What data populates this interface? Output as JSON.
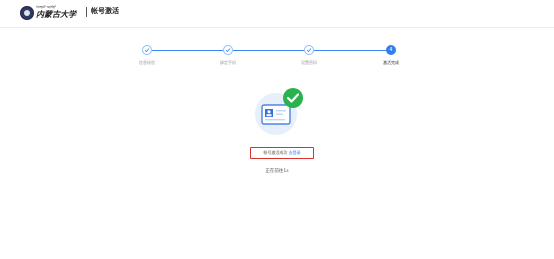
{
  "header": {
    "logo_sub": "ᠮᠣᠩᠭᠣᠯ ᠤᠨᠢᠪᠧᠷ",
    "logo_main": "内蒙古大学",
    "divider": "|",
    "title": "帐号激活"
  },
  "steps": [
    {
      "label": "信息校验",
      "state": "done"
    },
    {
      "label": "绑定手机",
      "state": "done"
    },
    {
      "label": "设置密码",
      "state": "done"
    },
    {
      "label": "激活完成",
      "state": "active",
      "number": "4"
    }
  ],
  "result": {
    "message": "帐号激活成功",
    "link": "去登录"
  },
  "redirect": {
    "text": "正在前往1s"
  },
  "colors": {
    "accent": "#2f7ff0",
    "success": "#2bb24c",
    "highlight_border": "#d9322b"
  },
  "icons": {
    "done_step": "check-icon",
    "illustration": "id-card-icon",
    "success": "success-check-icon"
  }
}
